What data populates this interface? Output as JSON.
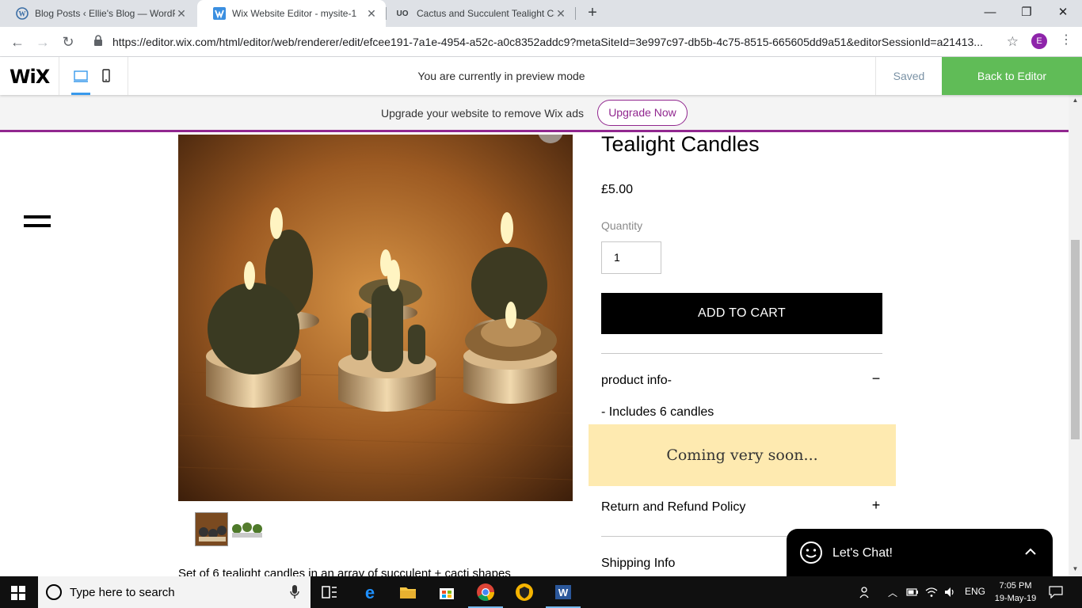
{
  "browser": {
    "tabs": [
      {
        "title": "Blog Posts ‹ Ellie's Blog — WordP",
        "favicon": "wordpress-icon"
      },
      {
        "title": "Wix Website Editor - mysite-1",
        "favicon": "wix-icon"
      },
      {
        "title": "Cactus and Succulent Tealight Ca",
        "favicon": "uo-icon",
        "favicon_text": "UO"
      }
    ],
    "url": "https://editor.wix.com/html/editor/web/renderer/edit/efcee191-7a1e-4954-a52c-a0c8352addc9?metaSiteId=3e997c97-db5b-4c75-8515-665605dd9a51&editorSessionId=a21413...",
    "profile_initial": "E"
  },
  "wix_bar": {
    "logo": "WiX",
    "preview_text": "You are currently in preview mode",
    "saved_label": "Saved",
    "back_label": "Back to Editor"
  },
  "ad_banner": {
    "text": "Upgrade your website to remove Wix ads",
    "button": "Upgrade Now"
  },
  "product": {
    "title": "Tealight Candles",
    "price": "£5.00",
    "quantity_label": "Quantity",
    "quantity_value": "1",
    "add_to_cart": "ADD TO CART",
    "accordion": [
      {
        "title": "product info-",
        "icon": "−",
        "content": "- Includes 6 candles"
      },
      {
        "title": "Return and Refund Policy",
        "icon": "+"
      },
      {
        "title": "Shipping Info",
        "icon": "+"
      }
    ],
    "description": "Set of 6 tealight candles in an array of succulent + cacti shapes"
  },
  "banner": {
    "text": "Coming very soon..."
  },
  "chat": {
    "label": "Let's Chat!"
  },
  "taskbar": {
    "search_placeholder": "Type here to search",
    "language": "ENG",
    "time": "7:05 PM",
    "date": "19-May-19"
  },
  "colors": {
    "wix_green": "#60bc57",
    "upgrade_purple": "#91278f",
    "coming_soon_bg": "#feeab0"
  }
}
